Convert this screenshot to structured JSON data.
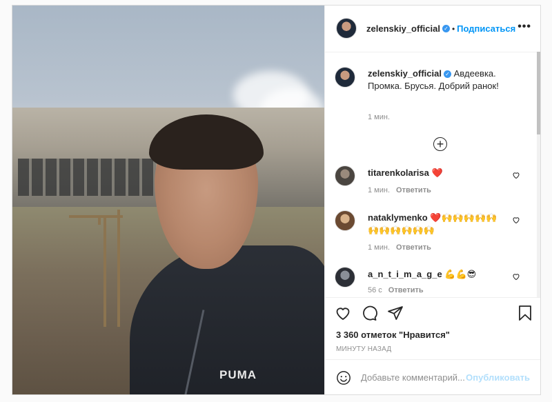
{
  "post": {
    "author": "zelenskiy_official",
    "follow_label": "Подписаться",
    "separator": "•",
    "more_label": "•••",
    "verified_mark": "✓",
    "photo_brand_text": "PUMA"
  },
  "caption": {
    "username": "zelenskiy_official",
    "text": "Авдеевка. Промка. Брусья. Добрий ранок!",
    "time": "1 мин.",
    "load_more_icon": "plus-circle-icon"
  },
  "comments": [
    {
      "username": "titarenkolarisa",
      "text": "❤️",
      "time": "1 мин.",
      "reply": "Ответить"
    },
    {
      "username": "nataklymenko",
      "text": "❤️🙌🙌🙌🙌🙌🙌🙌🙌🙌🙌🙌",
      "time": "1 мин.",
      "reply": "Ответить"
    },
    {
      "username": "a_n_t_i_m_a_g_e",
      "text": "💪💪😎",
      "time": "56 с",
      "reply": "Ответить"
    }
  ],
  "actions": {
    "likes": "3 360 отметок \"Нравится\"",
    "posted_ago": "МИНУТУ НАЗАД"
  },
  "add_comment": {
    "placeholder": "Добавьте комментарий...",
    "publish_label": "Опубликовать"
  },
  "colors": {
    "accent": "#0095f6",
    "publish_disabled": "#b2dffc",
    "heart": "#ed4956",
    "verified": "#3897f0"
  }
}
